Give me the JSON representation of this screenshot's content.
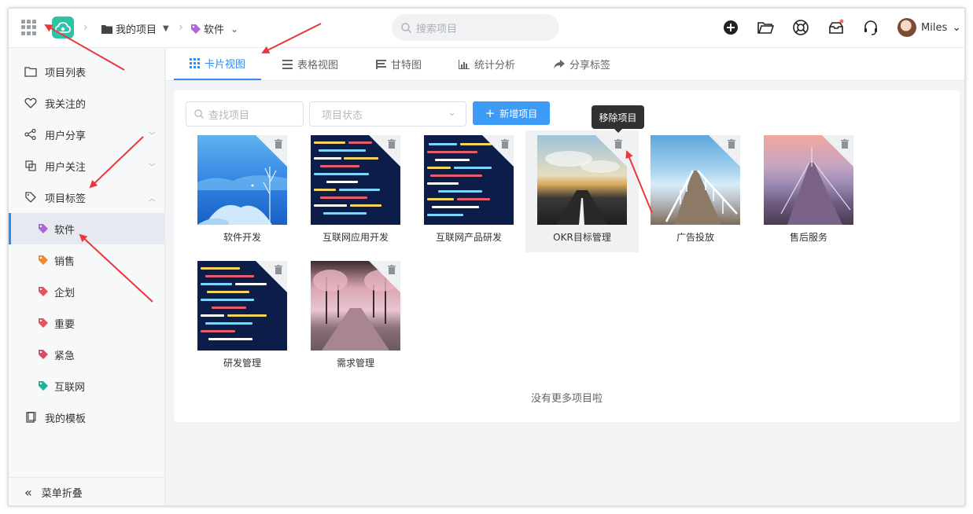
{
  "header": {
    "breadcrumb_project": "我的项目",
    "breadcrumb_tag": "软件",
    "search_placeholder": "搜索项目",
    "username": "Miles"
  },
  "sidebar": {
    "items": [
      {
        "label": "项目列表",
        "icon": "folder-open-icon"
      },
      {
        "label": "我关注的",
        "icon": "heart-icon"
      },
      {
        "label": "用户分享",
        "icon": "share-icon"
      },
      {
        "label": "用户关注",
        "icon": "copy-icon"
      },
      {
        "label": "项目标签",
        "icon": "tag-icon"
      }
    ],
    "tags": [
      {
        "label": "软件",
        "color": "#b065d8"
      },
      {
        "label": "销售",
        "color": "#f08a2c"
      },
      {
        "label": "企划",
        "color": "#e8505b"
      },
      {
        "label": "重要",
        "color": "#e8505b"
      },
      {
        "label": "紧急",
        "color": "#d84d6b"
      },
      {
        "label": "互联网",
        "color": "#1ab394"
      }
    ],
    "template": "我的模板",
    "collapse": "菜单折叠"
  },
  "tabs": [
    {
      "label": "卡片视图",
      "icon": "grid-icon"
    },
    {
      "label": "表格视图",
      "icon": "list-icon"
    },
    {
      "label": "甘特图",
      "icon": "gantt-icon"
    },
    {
      "label": "统计分析",
      "icon": "bar-chart-icon"
    },
    {
      "label": "分享标签",
      "icon": "share-arrow-icon"
    }
  ],
  "toolbar": {
    "search_placeholder": "查找项目",
    "status_placeholder": "项目状态",
    "new_button": "新增项目"
  },
  "tooltip": "移除项目",
  "projects": [
    {
      "name": "软件开发",
      "image": "blue-landscape"
    },
    {
      "name": "互联网应用开发",
      "image": "code-screen"
    },
    {
      "name": "互联网产品研发",
      "image": "code-screen"
    },
    {
      "name": "OKR目标管理",
      "image": "road-horizon"
    },
    {
      "name": "广告投放",
      "image": "pier-sky"
    },
    {
      "name": "售后服务",
      "image": "pier-sunset"
    },
    {
      "name": "研发管理",
      "image": "code-screen"
    },
    {
      "name": "需求管理",
      "image": "cherry-road"
    }
  ],
  "footer_text": "没有更多项目啦",
  "colors": {
    "accent": "#2d8cf0",
    "button": "#3d9bf5",
    "logo": "#2cc3a7",
    "annotation_arrow": "#e8383d"
  }
}
